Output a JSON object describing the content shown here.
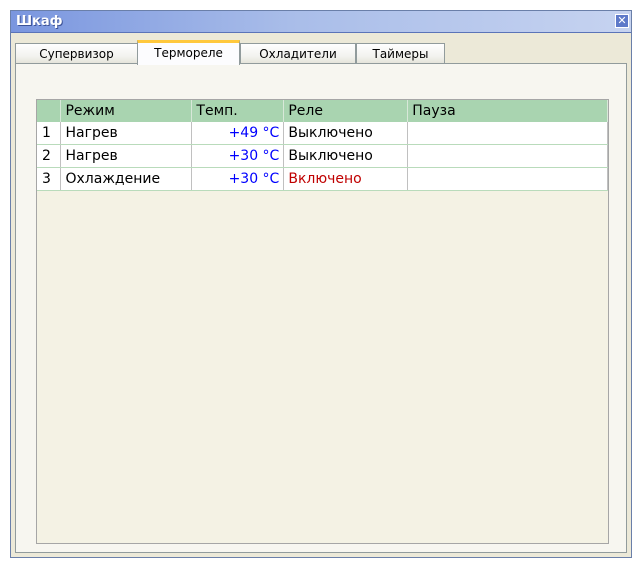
{
  "window": {
    "title": "Шкаф",
    "close_glyph": "✕"
  },
  "tabs": [
    {
      "label": "Супервизор",
      "active": false
    },
    {
      "label": "Термореле",
      "active": true
    },
    {
      "label": "Охладители",
      "active": false
    },
    {
      "label": "Таймеры",
      "active": false
    }
  ],
  "table": {
    "columns": [
      "",
      "Режим",
      "Темп.",
      "Реле",
      "Пауза"
    ],
    "rows": [
      {
        "num": "1",
        "mode": "Нагрев",
        "temp": "+49 °C",
        "relay": "Выключено",
        "pause": ""
      },
      {
        "num": "2",
        "mode": "Нагрев",
        "temp": "+30 °C",
        "relay": "Выключено",
        "pause": ""
      },
      {
        "num": "3",
        "mode": "Охлаждение",
        "temp": "+30 °C",
        "relay": "Включено",
        "pause": ""
      }
    ]
  },
  "colors": {
    "header_bg": "#a9d4b0",
    "temp_text": "#0000ff",
    "relay_on_text": "#c00000",
    "active_tab_accent": "#ffc83c"
  }
}
